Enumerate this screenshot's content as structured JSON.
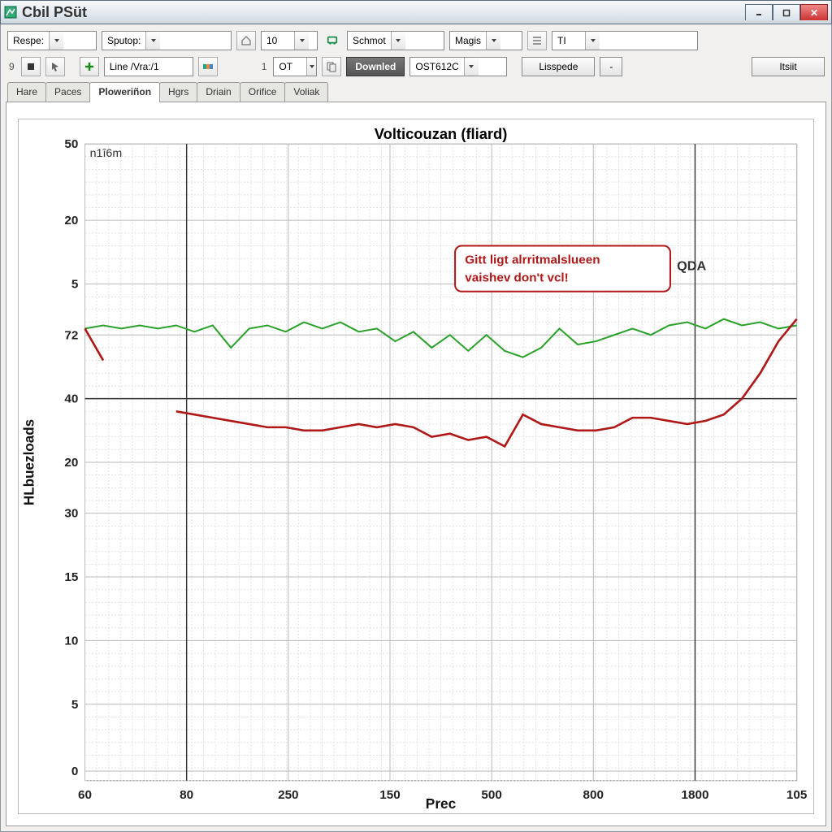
{
  "window": {
    "title": "Cbil PSüt"
  },
  "toolbar1": {
    "respe_label": "Respe:",
    "sputop_label": "Sputop:",
    "num10": "10",
    "schmot": "Schmot",
    "magis": "Magis",
    "ti": "TI"
  },
  "toolbar2": {
    "num9": "9",
    "line_label": "Line /Vra:/1",
    "num1": "1",
    "ot": "OT",
    "downled": "Downled",
    "ost": "OST612C",
    "lisspede": "Lisspede",
    "dash": "-",
    "itsiit": "Itsiit"
  },
  "tabs": [
    "Hare",
    "Paces",
    "Ploweriñon",
    "Hgrs",
    "Driain",
    "Orifice",
    "Voliak"
  ],
  "active_tab": 2,
  "chart_data": {
    "type": "line",
    "title": "Volticouzan (fliard)",
    "unit": "n1î6m",
    "xlabel": "Prec",
    "ylabel": "HLbuezloads",
    "x_ticks": [
      "60",
      "80",
      "250",
      "150",
      "500",
      "800",
      "1800",
      "105"
    ],
    "y_ticks_top": [
      "50",
      "20",
      "5"
    ],
    "y_ticks_main": [
      "72",
      "40",
      "20",
      "30",
      "15",
      "10",
      "5",
      "0"
    ],
    "hline_at_index": 1,
    "vline_at_tick": 1,
    "series": [
      {
        "name": "green",
        "color": "#2aa22a",
        "x": [
          0,
          1,
          2,
          3,
          4,
          5,
          6,
          7,
          8,
          9,
          10,
          11,
          12,
          13,
          14,
          15,
          16,
          17,
          18,
          19,
          20,
          21,
          22,
          23,
          24,
          25,
          26,
          27,
          28,
          29,
          30,
          31,
          32,
          33,
          34,
          35,
          36,
          37,
          38,
          39
        ],
        "y": [
          72,
          73,
          72,
          73,
          72,
          73,
          71,
          73,
          66,
          72,
          73,
          71,
          74,
          72,
          74,
          71,
          72,
          68,
          71,
          66,
          70,
          65,
          70,
          65,
          63,
          66,
          72,
          67,
          68,
          70,
          72,
          70,
          73,
          74,
          72,
          75,
          73,
          74,
          72,
          73
        ]
      },
      {
        "name": "red",
        "color": "#b01818",
        "x": [
          0,
          1,
          5,
          6,
          7,
          8,
          9,
          10,
          11,
          12,
          13,
          14,
          15,
          16,
          17,
          18,
          19,
          20,
          21,
          22,
          23,
          24,
          25,
          26,
          27,
          28,
          29,
          30,
          31,
          32,
          33,
          34,
          35,
          36,
          37,
          38,
          39
        ],
        "y": [
          72,
          62,
          46,
          45,
          44,
          43,
          42,
          41,
          41,
          40,
          40,
          41,
          42,
          41,
          42,
          41,
          38,
          39,
          37,
          38,
          35,
          45,
          42,
          41,
          40,
          40,
          41,
          44,
          44,
          43,
          42,
          43,
          45,
          50,
          58,
          68,
          75
        ]
      }
    ],
    "annotation": {
      "line1": "Gitt ligt alrritmalslueen",
      "line2": "vaishev don't vcl!",
      "qda": "QDA"
    }
  }
}
